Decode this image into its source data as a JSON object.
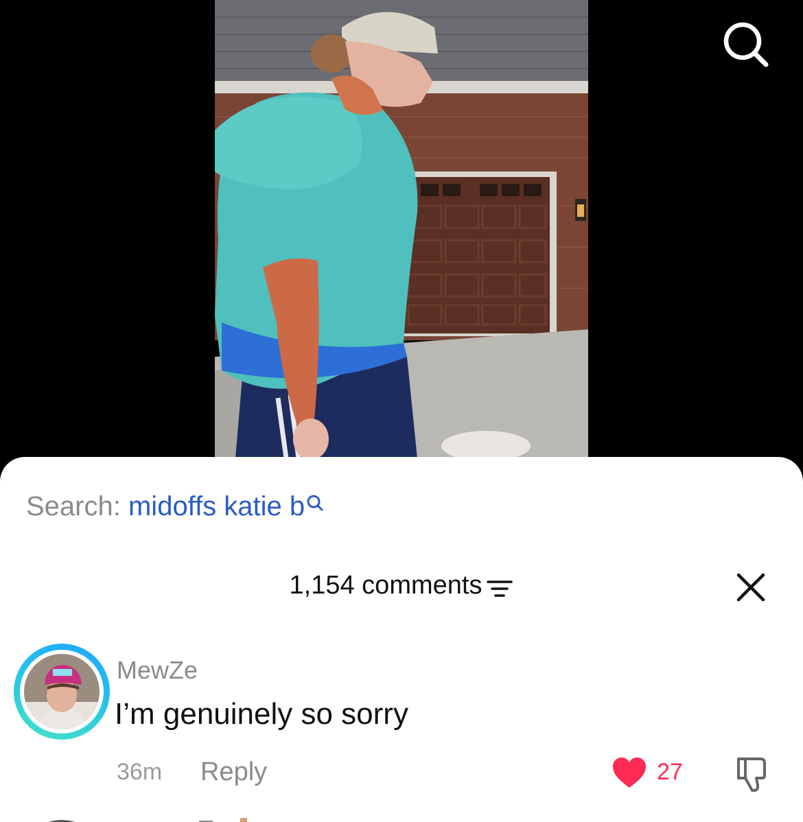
{
  "colors": {
    "background": "#000000",
    "sheet": "#ffffff",
    "query_blue": "#2b5cc6",
    "like_red": "#fe2c55",
    "muted_gray": "#8a8a8e",
    "avatar_ring": "#27c6e6"
  },
  "video": {
    "top_right_icon": "search-icon"
  },
  "search_suggestion": {
    "prefix": "Search:",
    "query": "midoffs katie b",
    "icon": "search-icon"
  },
  "comments_header": {
    "count_label": "1,154 comments",
    "filter_icon": "filter-icon",
    "close_icon": "close-icon"
  },
  "comment": {
    "username": "MewZe",
    "text": "I’m genuinely so sorry",
    "time": "36m",
    "reply_label": "Reply",
    "likes": "27",
    "like_icon": "heart-icon",
    "dislike_icon": "thumbs-down-icon"
  }
}
